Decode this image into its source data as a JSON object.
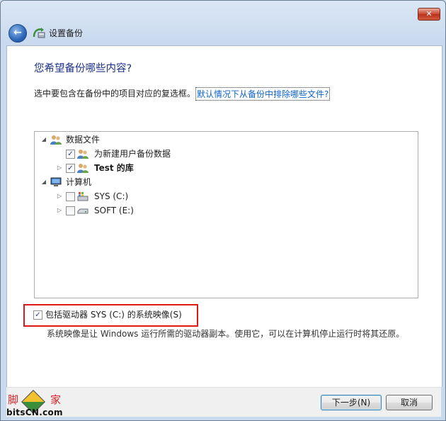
{
  "window": {
    "title": "设置备份",
    "close_glyph": "✕",
    "back_glyph": "←"
  },
  "page": {
    "question": "您希望备份哪些内容?",
    "instruction": "选中要包含在备份中的项目对应的复选框。",
    "help_link": "默认情况下从备份中排除哪些文件?"
  },
  "tree": {
    "nodes": [
      {
        "label": "数据文件",
        "icon": "users-icon",
        "expanded": true,
        "checkbox": false
      },
      {
        "label": "为新建用户备份数据",
        "icon": "users-icon",
        "checked": true
      },
      {
        "label": "Test 的库",
        "icon": "users-icon",
        "checked": true,
        "bold": true
      },
      {
        "label": "计算机",
        "icon": "computer-icon",
        "expanded": true,
        "checkbox": false
      },
      {
        "label": "SYS (C:)",
        "icon": "system-drive-icon",
        "checked": false
      },
      {
        "label": "SOFT (E:)",
        "icon": "drive-icon",
        "checked": false
      }
    ],
    "expand_glyph": "◢",
    "collapsed_glyph": "▷"
  },
  "system_image": {
    "label": "包括驱动器 SYS (C:) 的系统映像(S)",
    "checked": true,
    "description": "系统映像是让 Windows 运行所需的驱动器副本。使用它，可以在计算机停止运行时将其还原。"
  },
  "buttons": {
    "next": "下一步(N)",
    "cancel": "取消"
  },
  "check_glyph": "✓",
  "watermark": {
    "cn_left": "脚",
    "cn_right": "家",
    "en": "bitsCN.com"
  },
  "colors": {
    "title_blue": "#1e3287",
    "link_blue": "#0f63c9",
    "highlight_red": "#e01818"
  }
}
